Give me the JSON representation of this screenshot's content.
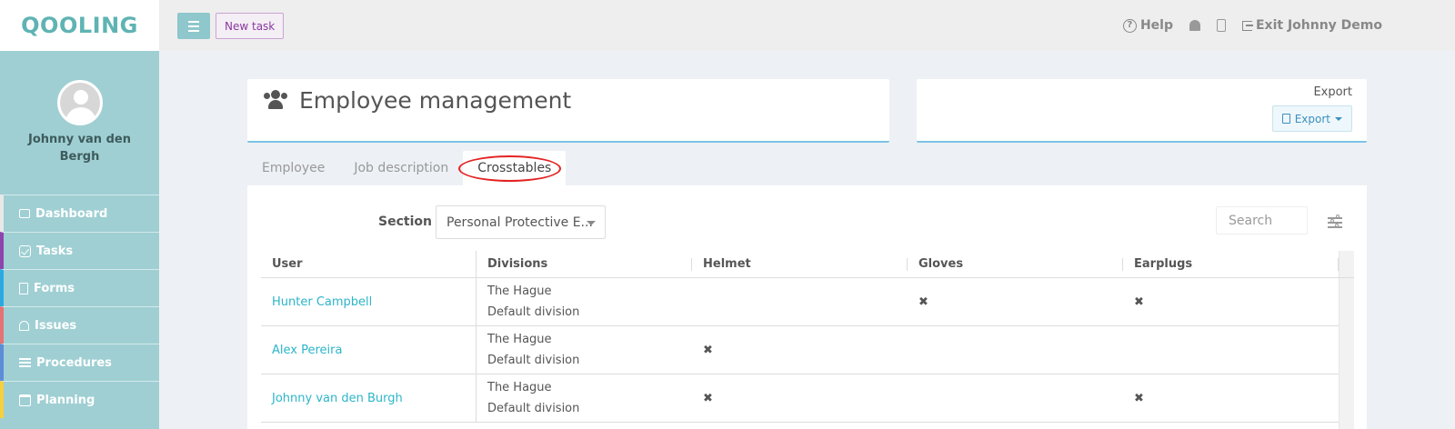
{
  "app": {
    "logo": "QOOLING",
    "brand_color": "#5fb3b3"
  },
  "sidebar": {
    "user_name": "Johnny van den Bergh",
    "items": [
      {
        "label": "Dashboard",
        "icon": "monitor-icon",
        "accent": "#e8e8e8"
      },
      {
        "label": "Tasks",
        "icon": "checkbox-icon",
        "accent": "#8e44ad"
      },
      {
        "label": "Forms",
        "icon": "document-icon",
        "accent": "#29abe2"
      },
      {
        "label": "Issues",
        "icon": "bell-icon",
        "accent": "#e57373"
      },
      {
        "label": "Procedures",
        "icon": "list-icon",
        "accent": "#5c8dd6"
      },
      {
        "label": "Planning",
        "icon": "calendar-icon",
        "accent": "#f4d03f"
      }
    ]
  },
  "topbar": {
    "new_task_label": "New task",
    "help_label": "Help",
    "exit_label": "Exit Johnny Demo"
  },
  "header": {
    "title": "Employee management",
    "export_label": "Export",
    "export_button_label": "Export"
  },
  "tabs": [
    {
      "label": "Employee",
      "active": false
    },
    {
      "label": "Job description",
      "active": false
    },
    {
      "label": "Crosstables",
      "active": true
    }
  ],
  "filters": {
    "section_label": "Section",
    "section_value": "Personal Protective E...",
    "search_placeholder": "Search"
  },
  "table": {
    "columns": [
      "User",
      "Divisions",
      "Helmet",
      "Gloves",
      "Earplugs"
    ],
    "rows": [
      {
        "user": "Hunter Campbell",
        "divisions": [
          "The Hague",
          "Default division"
        ],
        "helmet": "",
        "gloves": "✖",
        "earplugs": "✖"
      },
      {
        "user": "Alex Pereira",
        "divisions": [
          "The Hague",
          "Default division"
        ],
        "helmet": "✖",
        "gloves": "",
        "earplugs": ""
      },
      {
        "user": "Johnny van den Burgh",
        "divisions": [
          "The Hague",
          "Default division"
        ],
        "helmet": "✖",
        "gloves": "",
        "earplugs": "✖"
      }
    ]
  }
}
